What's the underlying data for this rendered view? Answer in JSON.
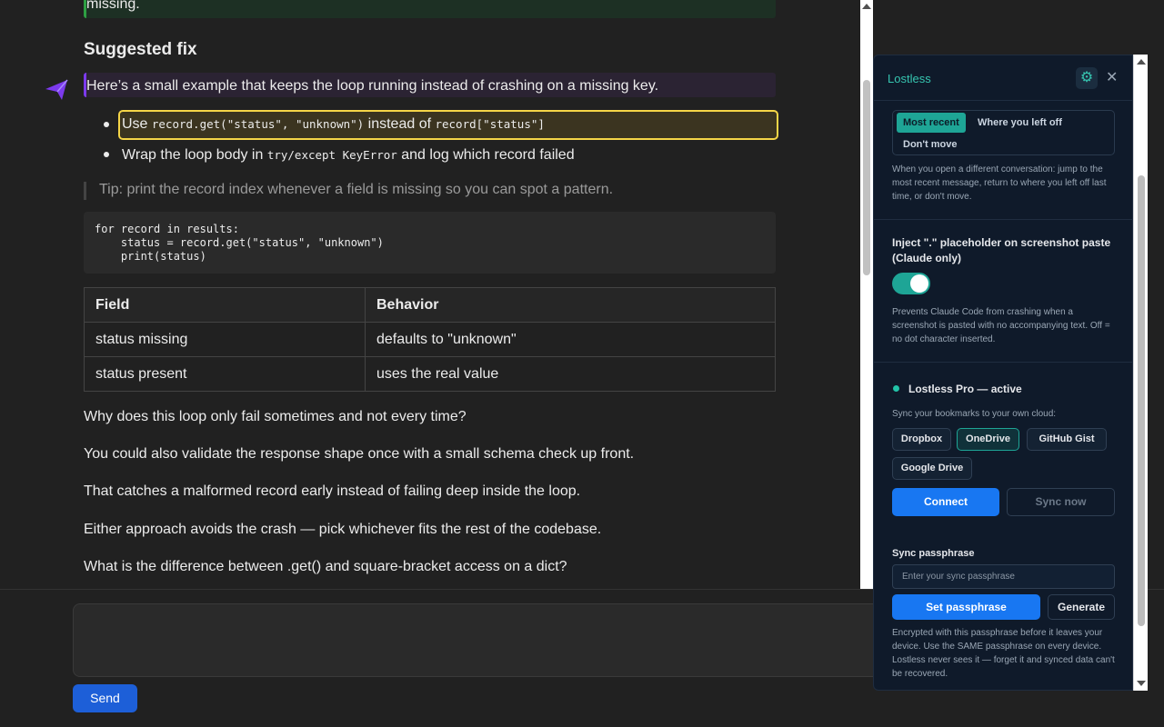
{
  "chat": {
    "top_fragment": "missing.",
    "heading": "Suggested fix",
    "intro": "Here’s a small example that keeps the loop running instead of crashing on a missing key.",
    "bullet1_pre": "Use ",
    "bullet1_code1": "record.get(\"status\", \"unknown\")",
    "bullet1_mid": " instead of ",
    "bullet1_code2": "record[\"status\"]",
    "bullet2_pre": "Wrap the loop body in ",
    "bullet2_code": "try/except KeyError",
    "bullet2_post": " and log which record failed",
    "tip": "Tip: print the record index whenever a field is missing so you can spot a pattern.",
    "code": "for record in results:\n    status = record.get(\"status\", \"unknown\")\n    print(status)",
    "table": {
      "headers": [
        "Field",
        "Behavior"
      ],
      "rows": [
        [
          "status missing",
          "defaults to \"unknown\""
        ],
        [
          "status present",
          "uses the real value"
        ]
      ]
    },
    "paragraphs": [
      "Why does this loop only fail sometimes and not every time?",
      "You could also validate the response shape once with a small schema check up front.",
      "That catches a malformed record early instead of failing deep inside the loop.",
      "Either approach avoids the crash — pick whichever fits the rest of the codebase.",
      "What is the difference between .get() and square-bracket access on a dict?"
    ]
  },
  "composer": {
    "send_label": "Send"
  },
  "panel": {
    "title": "Lostless",
    "gear_icon": "gear-icon",
    "close_icon": "close-icon",
    "jump_options": [
      "Most recent",
      "Where you left off",
      "Don't move"
    ],
    "jump_help": "When you open a different conversation: jump to the most recent message, return to where you left off last time, or don't move.",
    "inject_title": "Inject \".\" placeholder on screenshot paste (Claude only)",
    "inject_help": "Prevents Claude Code from crashing when a screenshot is pasted with no accompanying text. Off = no dot character inserted.",
    "pro_status": "Lostless Pro — active",
    "sync_label": "Sync your bookmarks to your own cloud:",
    "providers": [
      "Dropbox",
      "OneDrive",
      "GitHub Gist",
      "Google Drive"
    ],
    "connect_label": "Connect",
    "sync_now_label": "Sync now",
    "passphrase_title": "Sync passphrase",
    "passphrase_placeholder": "Enter your sync passphrase",
    "set_passphrase_label": "Set passphrase",
    "generate_label": "Generate",
    "passphrase_help": "Encrypted with this passphrase before it leaves your device. Use the SAME passphrase on every device. Lostless never sees it — forget it and synced data can't be recovered."
  },
  "colors": {
    "accent": "#1ea596",
    "primary": "#1877f2",
    "highlight": "#f5d547"
  }
}
